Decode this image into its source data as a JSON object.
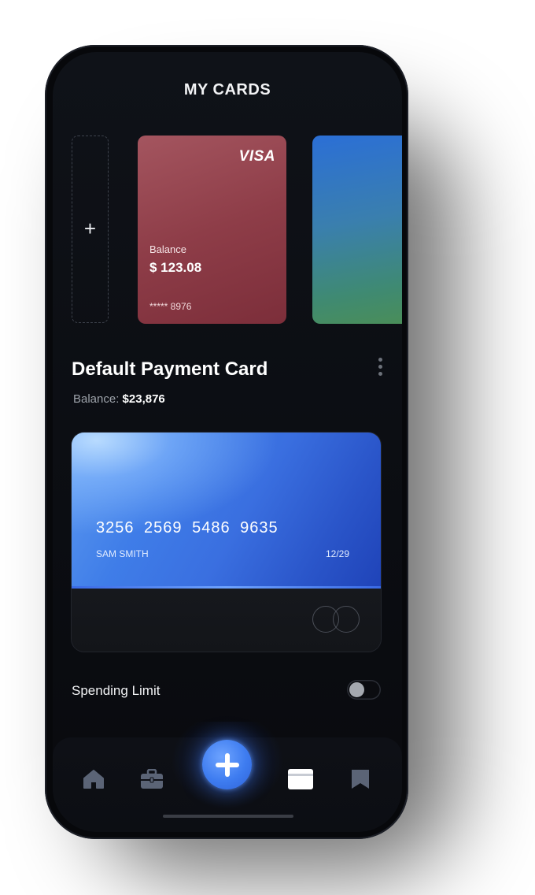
{
  "header": {
    "title": "MY CARDS"
  },
  "cards_carousel": {
    "add_card_symbol": "+",
    "red_card": {
      "brand": "VISA",
      "balance_label": "Balance",
      "balance_value": "$ 123.08",
      "masked_number": "***** 8976",
      "color": "#8e3d48"
    },
    "green_card": {
      "color": "#3a7fae"
    }
  },
  "default_card": {
    "section_title": "Default Payment Card",
    "balance_label": "Balance:",
    "balance_value": "$23,876",
    "card_number": "3256  2569  5486  9635",
    "holder": "SAM SMITH",
    "expiry": "12/29",
    "accent_color": "#3f7de8"
  },
  "spending_limit": {
    "label": "Spending Limit",
    "enabled": false
  },
  "nav": {
    "items": [
      {
        "icon": "home-icon",
        "active": false
      },
      {
        "icon": "briefcase-icon",
        "active": false
      },
      {
        "icon": "plus-icon",
        "active": false,
        "fab": true
      },
      {
        "icon": "cards-icon",
        "active": true
      },
      {
        "icon": "bookmark-icon",
        "active": false
      }
    ],
    "inactive_color": "#5b6476",
    "active_color": "#ffffff"
  }
}
